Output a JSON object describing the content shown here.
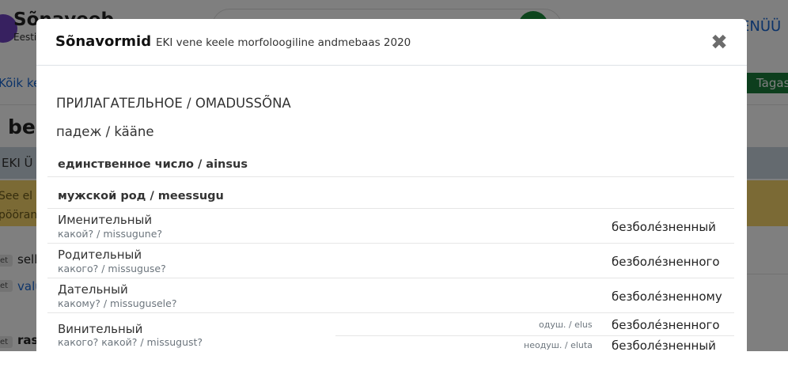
{
  "background": {
    "app_title": "Sõnaveeb",
    "app_subtitle": "Eesti",
    "menu_label": "ENÜÜ",
    "nav_link": "Kõik ke",
    "green_button": "Tagas",
    "headword": "bez",
    "band_text": "EKI Ü",
    "warning_line1": "See el",
    "warning_line2": "pööran",
    "rows": [
      {
        "tag": "et",
        "text": "sell"
      },
      {
        "tag": "et",
        "text": "valu"
      },
      {
        "tag": "et",
        "text": "ras"
      }
    ]
  },
  "modal": {
    "title": "Sõnavormid",
    "subtitle": "EKI vene keele morfoloogiline andmebaas 2020",
    "close_symbol": "✖",
    "pos_heading": "ПРИЛАГАТЕЛЬНОЕ / OMADUSSÕNA",
    "case_heading": "падеж / kääne",
    "number_row": "единственное число / ainsus",
    "gender_row": "мужской род / meessugu",
    "cases": [
      {
        "name": "Именительный",
        "question": "какой? / missugune?",
        "form": "безболе́зненный"
      },
      {
        "name": "Родительный",
        "question": "какого? / missuguse?",
        "form": "безболе́зненного"
      },
      {
        "name": "Дательный",
        "question": "какому? / missugusele?",
        "form": "безболе́зненному"
      }
    ],
    "accusative": {
      "name": "Винительный",
      "question": "какого? какой? / missugust?",
      "animate_tag": "одуш. / elus",
      "animate_form": "безболе́зненного",
      "inanimate_tag": "неодуш. / eluta",
      "inanimate_form": "безболе́зненный"
    }
  },
  "colors": {
    "overlay": "#00000080",
    "brand_green": "#1a7d3a",
    "link_blue": "#1967d2",
    "warning_yellow": "#f7d46b",
    "muted_text": "#6c757d"
  },
  "icons": {
    "close": "close-icon"
  }
}
